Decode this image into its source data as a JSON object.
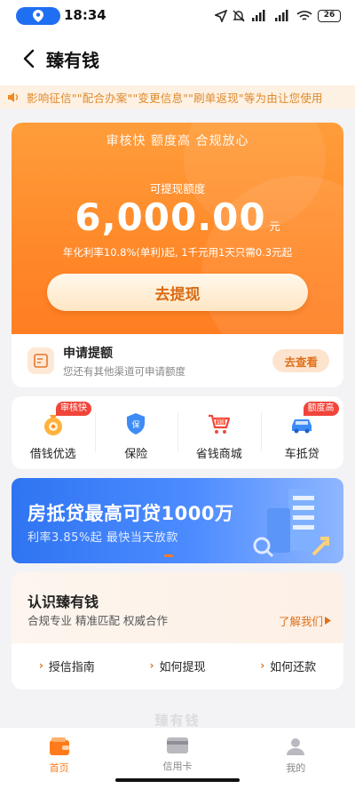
{
  "status_bar": {
    "time": "18:34",
    "battery": "26"
  },
  "nav": {
    "title": "臻有钱"
  },
  "notice": {
    "text": "影响征信\"\"配合办案\"\"变更信息\"\"刷单返现\"等为由让您使用"
  },
  "hero": {
    "tagline": "审核快 额度高 合规放心",
    "amount_label": "可提现额度",
    "amount": "6,000.00",
    "unit": "元",
    "rate_text": "年化利率10.8%(单利)起, 1千元用1天只需0.3元起",
    "withdraw_button": "去提现"
  },
  "apply": {
    "title": "申请提额",
    "subtitle": "您还有其他渠道可申请额度",
    "button": "去查看"
  },
  "quick_entries": [
    {
      "label": "借钱优选",
      "badge": "审核快"
    },
    {
      "label": "保险",
      "badge": ""
    },
    {
      "label": "省钱商城",
      "badge": ""
    },
    {
      "label": "车抵贷",
      "badge": "额度高"
    }
  ],
  "banner": {
    "title": "房抵贷最高可贷1000万",
    "subtitle": "利率3.85%起  最快当天放款"
  },
  "about": {
    "title": "认识臻有钱",
    "subtitle": "合规专业 精准匹配 权威合作",
    "more": "了解我们",
    "links": [
      "授信指南",
      "如何提现",
      "如何还款"
    ]
  },
  "watermark": "臻有钱",
  "tabbar": {
    "tabs": [
      {
        "label": "首页",
        "active": true
      },
      {
        "label": "信用卡",
        "active": false
      },
      {
        "label": "我的",
        "active": false
      }
    ]
  },
  "colors": {
    "accent": "#ff7a1a",
    "hero_top": "#ff9d3b",
    "banner_blue": "#2f74f2",
    "badge_red": "#f0453a"
  }
}
